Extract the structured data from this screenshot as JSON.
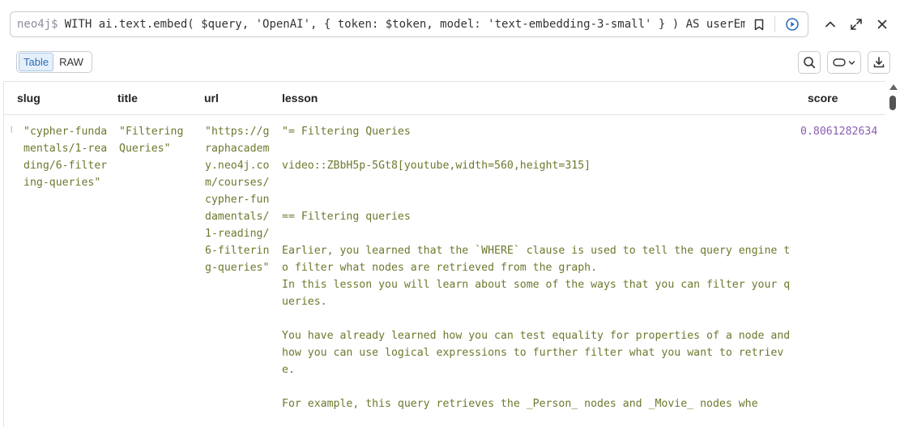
{
  "query_bar": {
    "prompt": "neo4j$",
    "query": "WITH ai.text.embed( $query, 'OpenAI', { token: $token, model: 'text-embedding-3-small' } ) AS userEmb"
  },
  "view_toggle": {
    "table_label": "Table",
    "raw_label": "RAW"
  },
  "table": {
    "columns": [
      "slug",
      "title",
      "url",
      "lesson",
      "score"
    ],
    "row": {
      "slug": "\"cypher-fundamentals/1-reading/6-filtering-queries\"",
      "title": "\"Filtering Queries\"",
      "url": "\"https://graphacademy.neo4j.com/courses/cypher-fundamentals/1-reading/6-filtering-queries\"",
      "lesson": "\"= Filtering Queries\n\nvideo::ZBbH5p-5Gt8[youtube,width=560,height=315]\n\n\n== Filtering queries\n\nEarlier, you learned that the `WHERE` clause is used to tell the query engine to filter what nodes are retrieved from the graph.\nIn this lesson you will learn about some of the ways that you can filter your queries.\n\nYou have already learned how you can test equality for properties of a node and how you can use logical expressions to further filter what you want to retrieve.\n\nFor example, this query retrieves the _Person_ nodes and _Movie_ nodes whe",
      "score": "0.8061282634"
    }
  },
  "colors": {
    "string": "#6b7a2e",
    "number": "#8a5fb3",
    "accent": "#2e6fb7"
  }
}
